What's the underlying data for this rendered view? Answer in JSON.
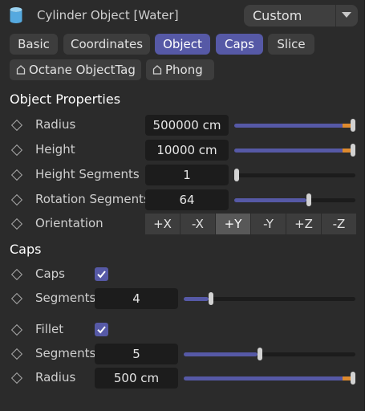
{
  "header": {
    "title": "Cylinder Object [Water]",
    "object_icon": "cylinder-icon",
    "preset": "Custom"
  },
  "tabs": [
    {
      "label": "Basic",
      "active": false
    },
    {
      "label": "Coordinates",
      "active": false
    },
    {
      "label": "Object",
      "active": true
    },
    {
      "label": "Caps",
      "active": true
    },
    {
      "label": "Slice",
      "active": false
    }
  ],
  "tags": [
    {
      "label": "Octane ObjectTag",
      "icon": "tag-icon"
    },
    {
      "label": "Phong",
      "icon": "tag-icon"
    }
  ],
  "object_properties": {
    "title": "Object Properties",
    "radius": {
      "label": "Radius",
      "value": "500000 cm",
      "slider_level": 1.0
    },
    "height": {
      "label": "Height",
      "value": "10000 cm",
      "slider_level": 1.0
    },
    "height_segments": {
      "label": "Height Segments",
      "value": "1",
      "slider_level": 0.0
    },
    "rotation_segments": {
      "label": "Rotation Segments",
      "value": "64",
      "slider_level": 0.62
    },
    "orientation": {
      "label": "Orientation",
      "options": [
        "+X",
        "-X",
        "+Y",
        "-Y",
        "+Z",
        "-Z"
      ],
      "selected": "+Y"
    }
  },
  "caps": {
    "title": "Caps",
    "caps": {
      "label": "Caps",
      "checked": true
    },
    "segments": {
      "label": "Segments",
      "value": "4",
      "slider_level": 0.15
    },
    "fillet": {
      "label": "Fillet",
      "checked": true
    },
    "fillet_segments": {
      "label": "Segments",
      "value": "5",
      "slider_level": 0.44
    },
    "fillet_radius": {
      "label": "Radius",
      "value": "500 cm",
      "slider_level": 1.0
    }
  },
  "colors": {
    "accent": "#5659a6",
    "overflow": "#dd8a2e",
    "background": "#2b2b2b",
    "field": "#1c1c1c"
  }
}
